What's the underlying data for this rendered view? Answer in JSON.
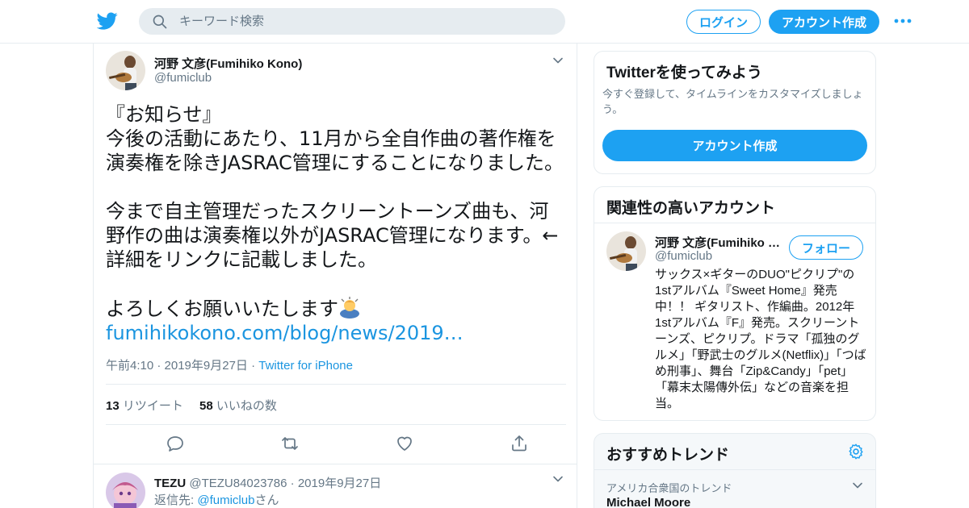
{
  "header": {
    "search_placeholder": "キーワード検索",
    "login_label": "ログイン",
    "signup_label": "アカウント作成",
    "brand_color": "#1da1f2"
  },
  "tweet": {
    "author_name": "河野 文彦(Fumihiko Kono)",
    "author_handle": "@fumiclub",
    "text": "『お知らせ』\n今後の活動にあたり、11月から全自作曲の著作権を演奏権を除きJASRAC管理にすることになりました。\n\n今まで自主管理だったスクリーントーンズ曲も、河野作の曲は演奏権以外がJASRAC管理になります。←詳細をリンクに記載しました。\n\nよろしくお願いいたします",
    "emoji": "man-bowing-emoji",
    "link_text": "fumihikokono.com/blog/news/2019…",
    "timestamp": "午前4:10 · 2019年9月27日",
    "meta_separator": "·",
    "source": "Twitter for iPhone",
    "retweet_count": "13",
    "retweet_label": "リツイート",
    "like_count": "58",
    "like_label": "いいねの数"
  },
  "reply": {
    "author_name": "TEZU",
    "author_handle": "@TEZU84023786",
    "date": "· 2019年9月27日",
    "reply_to_prefix": "返信先: ",
    "reply_to_handle": "@fumiclub",
    "reply_to_suffix": "さん"
  },
  "signup_card": {
    "title": "Twitterを使ってみよう",
    "description": "今すぐ登録して、タイムラインをカスタマイズしましょう。",
    "button_label": "アカウント作成"
  },
  "related_card": {
    "title": "関連性の高いアカウント",
    "name": "河野 文彦(Fumihiko Kono)",
    "handle": "@fumiclub",
    "follow_label": "フォロー",
    "bio": "サックス×ギターのDUO\"ピクリプ\"の1stアルバム『Sweet Home』発売中！！ ギタリスト、作編曲。2012年1stアルバム『F』発売。スクリーントーンズ、ピクリプ。ドラマ「孤独のグルメ」「野武士のグルメ(Netflix)」「つばめ刑事」、舞台「Zip&Candy」「pet」「幕末太陽傳外伝」などの音楽を担当。"
  },
  "trends_card": {
    "title": "おすすめトレンド",
    "location_label": "アメリカ合衆国のトレンド",
    "top_trend": "Michael Moore"
  }
}
